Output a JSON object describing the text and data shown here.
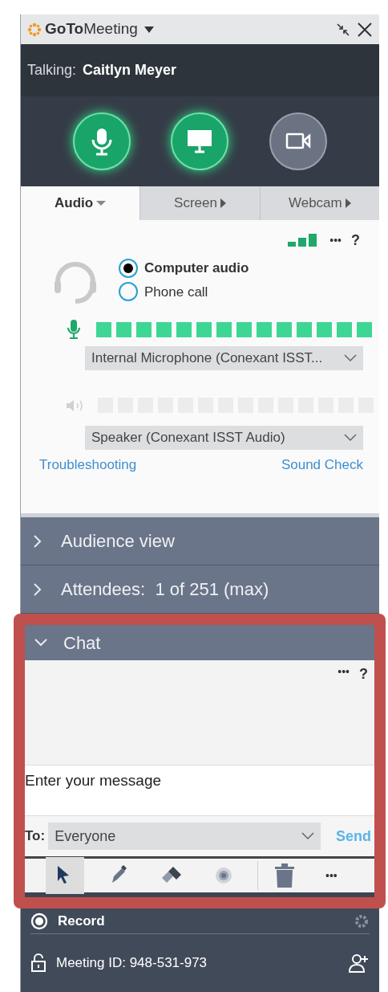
{
  "window": {
    "title": "**GoTo**Meeting"
  },
  "talking": {
    "label": "Talking:",
    "name": "Caitlyn Meyer"
  },
  "controls": [
    {
      "kind": "mic",
      "on": true
    },
    {
      "kind": "screen",
      "on": true
    },
    {
      "kind": "webcam",
      "on": false
    }
  ],
  "tabs": [
    {
      "label": "Audio",
      "selected": true
    },
    {
      "label": "Screen",
      "selected": false
    },
    {
      "label": "Webcam",
      "selected": false
    }
  ],
  "audio": {
    "more": "•••",
    "help": "?",
    "options": [
      {
        "label": "Computer audio",
        "selected": true
      },
      {
        "label": "Phone call",
        "selected": false
      }
    ],
    "mic_meter": {
      "level": 1
    },
    "mic_device": "Internal Microphone (Conexant ISST...",
    "speaker_meter": {
      "level": 0
    },
    "speaker_device": "Speaker (Conexant ISST Audio)",
    "links": [
      "Troubleshooting",
      "Sound Check"
    ]
  },
  "sections": [
    {
      "label": "Audience view",
      "expanded": false
    },
    {
      "label": "Attendees:  1 of 251 (max)",
      "expanded": false
    }
  ],
  "chat": {
    "label": "Chat",
    "expanded": true,
    "more": "•••",
    "help": "?",
    "placeholder": "Enter your message",
    "to_label": "To:",
    "recipient": "Everyone",
    "send": "Send",
    "tools": [
      {
        "kind": "pointer",
        "selected": true
      },
      {
        "kind": "pen",
        "selected": false
      },
      {
        "kind": "eraser",
        "selected": false
      },
      {
        "kind": "spotlight",
        "selected": false
      }
    ],
    "more_tools": "•••"
  },
  "footer": {
    "record": "Record",
    "meeting_id": "Meeting ID: 948-531-973"
  }
}
